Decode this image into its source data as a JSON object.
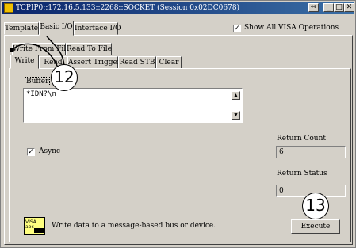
{
  "window": {
    "title": "TCPIP0::172.16.5.133::2268::SOCKET (Session 0x02DC0678)",
    "restore_icon": "⇔",
    "minimize_icon": "_",
    "maximize_icon": "□",
    "close_icon": "✕"
  },
  "top_tabs": [
    {
      "label": "Template"
    },
    {
      "label": "Basic I/O"
    },
    {
      "label": "Interface I/O"
    }
  ],
  "show_all": {
    "label": "Show All VISA Operations",
    "checked": "✓"
  },
  "file_tabs": [
    {
      "label": "Write From File"
    },
    {
      "label": "Read To File"
    }
  ],
  "op_tabs": [
    {
      "label": "Write"
    },
    {
      "label": "Read"
    },
    {
      "label": "Assert Trigger"
    },
    {
      "label": "Read STB"
    },
    {
      "label": "Clear"
    }
  ],
  "buffer": {
    "label": "Buffer",
    "value": "*IDN?\\n"
  },
  "return_count": {
    "label": "Return Count",
    "value": "6"
  },
  "return_status": {
    "label": "Return Status",
    "value": "0"
  },
  "async": {
    "label": "Async",
    "checked": "✓"
  },
  "help_text": "Write data to a message-based bus or device.",
  "execute_button": {
    "label": "Execute"
  },
  "callouts": {
    "a": "12",
    "b": "13"
  }
}
